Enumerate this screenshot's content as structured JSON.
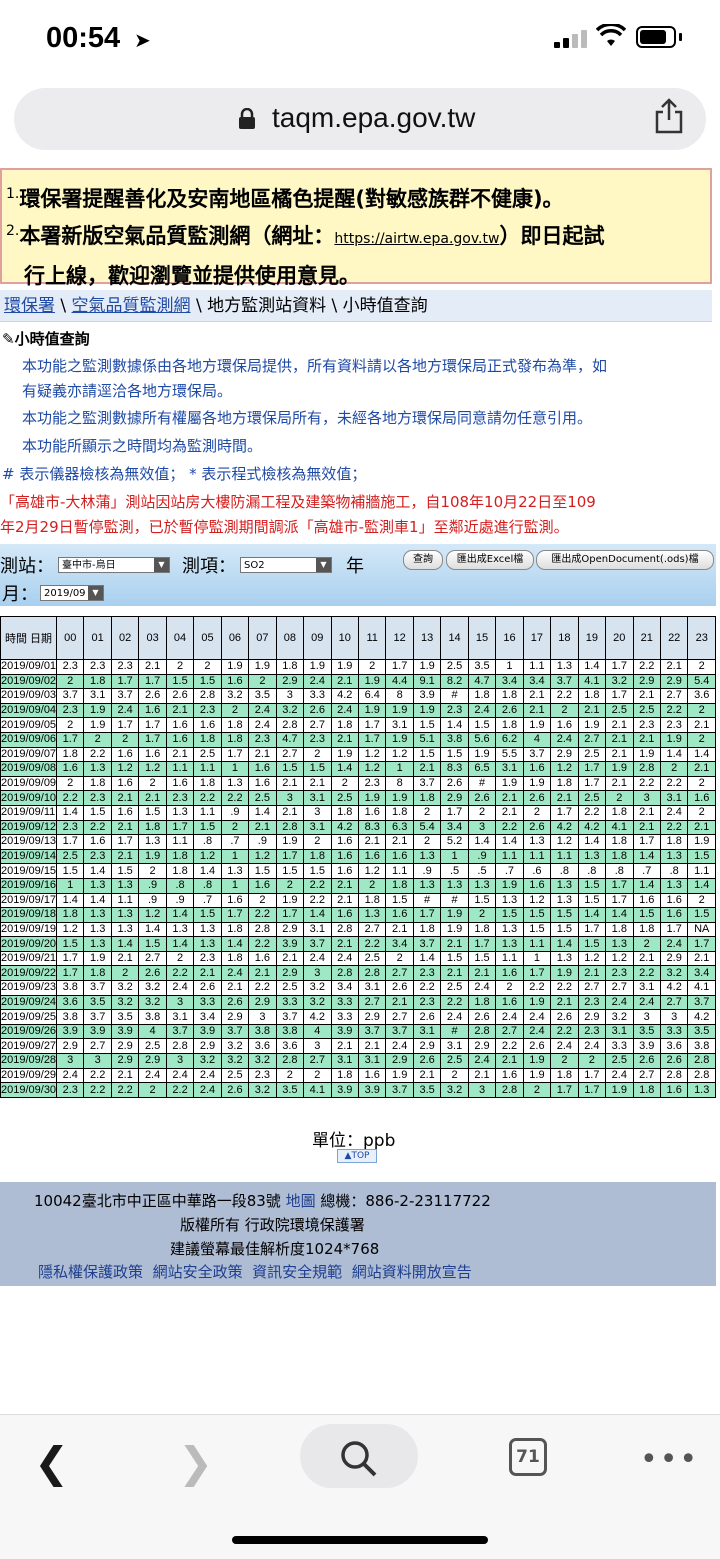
{
  "status": {
    "time": "00:54"
  },
  "browser": {
    "url": "taqm.epa.gov.tw",
    "tabs_count": "71"
  },
  "notice": {
    "item1_num": "1.",
    "item1": "環保署提醒善化及安南地區橘色提醒(對敏感族群不健康)。",
    "item2_num": "2.",
    "item2_a": "本署新版空氣品質監測網（網址：",
    "item2_link": "https://airtw.epa.gov.tw",
    "item2_b": "）即日起試",
    "item2_c": "行上線，歡迎瀏覽並提供使用意見。"
  },
  "breadcrumb": {
    "c1": "環保署",
    "c2": "空氣品質監測網",
    "c3": "地方監測站資料",
    "c4": "小時值查詢"
  },
  "page_title": "小時值查詢",
  "info": {
    "l1": "本功能之監測數據係由各地方環保局提供，所有資料請以各地方環保局正式發布為準，如",
    "l2": "有疑義亦請逕洽各地方環保局。",
    "l3": "本功能之監測數據所有權屬各地方環保局所有，未經各地方環保局同意請勿任意引用。",
    "l4": "本功能所顯示之時間均為監測時間。",
    "l5": "# 表示儀器檢核為無效值； * 表示程式檢核為無效值；",
    "w1": "「高雄市-大林蒲」測站因站房大樓防漏工程及建築物補牆施工，自108年10月22日至109",
    "w2": "年2月29日暫停監測，已於暫停監測期間調派「高雄市-監測車1」至鄰近處進行監測。"
  },
  "controls": {
    "station_label": "測站：",
    "station_value": "臺中市-烏日",
    "item_label": "測項：",
    "item_value": "SO2",
    "year_label": "年",
    "month_label": "月：",
    "month_value": "2019/09",
    "btn_query": "查詢",
    "btn_excel": "匯出成Excel檔",
    "btn_ods": "匯出成OpenDocument(.ods)檔"
  },
  "table": {
    "header_first": "時間 日期",
    "hours": [
      "00",
      "01",
      "02",
      "03",
      "04",
      "05",
      "06",
      "07",
      "08",
      "09",
      "10",
      "11",
      "12",
      "13",
      "14",
      "15",
      "16",
      "17",
      "18",
      "19",
      "20",
      "21",
      "22",
      "23"
    ],
    "rows": [
      [
        "2019/09/01",
        "2.3",
        "2.3",
        "2.3",
        "2.1",
        "2",
        "2",
        "1.9",
        "1.9",
        "1.8",
        "1.9",
        "1.9",
        "2",
        "1.7",
        "1.9",
        "2.5",
        "3.5",
        "1",
        "1.1",
        "1.3",
        "1.4",
        "1.7",
        "2.2",
        "2.1",
        "2"
      ],
      [
        "2019/09/02",
        "2",
        "1.8",
        "1.7",
        "1.7",
        "1.5",
        "1.5",
        "1.6",
        "2",
        "2.9",
        "2.4",
        "2.1",
        "1.9",
        "4.4",
        "9.1",
        "8.2",
        "4.7",
        "3.4",
        "3.4",
        "3.7",
        "4.1",
        "3.2",
        "2.9",
        "2.9",
        "5.4"
      ],
      [
        "2019/09/03",
        "3.7",
        "3.1",
        "3.7",
        "2.6",
        "2.6",
        "2.8",
        "3.2",
        "3.5",
        "3",
        "3.3",
        "4.2",
        "6.4",
        "8",
        "3.9",
        "#",
        "1.8",
        "1.8",
        "2.1",
        "2.2",
        "1.8",
        "1.7",
        "2.1",
        "2.7",
        "3.6"
      ],
      [
        "2019/09/04",
        "2.3",
        "1.9",
        "2.4",
        "1.6",
        "2.1",
        "2.3",
        "2",
        "2.4",
        "3.2",
        "2.6",
        "2.4",
        "1.9",
        "1.9",
        "1.9",
        "2.3",
        "2.4",
        "2.6",
        "2.1",
        "2",
        "2.1",
        "2.5",
        "2.5",
        "2.2",
        "2"
      ],
      [
        "2019/09/05",
        "2",
        "1.9",
        "1.7",
        "1.7",
        "1.6",
        "1.6",
        "1.8",
        "2.4",
        "2.8",
        "2.7",
        "1.8",
        "1.7",
        "3.1",
        "1.5",
        "1.4",
        "1.5",
        "1.8",
        "1.9",
        "1.6",
        "1.9",
        "2.1",
        "2.3",
        "2.3",
        "2.1"
      ],
      [
        "2019/09/06",
        "1.7",
        "2",
        "2",
        "1.7",
        "1.6",
        "1.8",
        "1.8",
        "2.3",
        "4.7",
        "2.3",
        "2.1",
        "1.7",
        "1.9",
        "5.1",
        "3.8",
        "5.6",
        "6.2",
        "4",
        "2.4",
        "2.7",
        "2.1",
        "2.1",
        "1.9",
        "2"
      ],
      [
        "2019/09/07",
        "1.8",
        "2.2",
        "1.6",
        "1.6",
        "2.1",
        "2.5",
        "1.7",
        "2.1",
        "2.7",
        "2",
        "1.9",
        "1.2",
        "1.2",
        "1.5",
        "1.5",
        "1.9",
        "5.5",
        "3.7",
        "2.9",
        "2.5",
        "2.1",
        "1.9",
        "1.4",
        "1.4"
      ],
      [
        "2019/09/08",
        "1.6",
        "1.3",
        "1.2",
        "1.2",
        "1.1",
        "1.1",
        "1",
        "1.6",
        "1.5",
        "1.5",
        "1.4",
        "1.2",
        "1",
        "2.1",
        "8.3",
        "6.5",
        "3.1",
        "1.6",
        "1.2",
        "1.7",
        "1.9",
        "2.8",
        "2",
        "2.1"
      ],
      [
        "2019/09/09",
        "2",
        "1.8",
        "1.6",
        "2",
        "1.6",
        "1.8",
        "1.3",
        "1.6",
        "2.1",
        "2.1",
        "2",
        "2.3",
        "8",
        "3.7",
        "2.6",
        "#",
        "1.9",
        "1.9",
        "1.8",
        "1.7",
        "2.1",
        "2.2",
        "2.2",
        "2"
      ],
      [
        "2019/09/10",
        "2.2",
        "2.3",
        "2.1",
        "2.1",
        "2.3",
        "2.2",
        "2.2",
        "2.5",
        "3",
        "3.1",
        "2.5",
        "1.9",
        "1.9",
        "1.8",
        "2.9",
        "2.6",
        "2.1",
        "2.6",
        "2.1",
        "2.5",
        "2",
        "3",
        "3.1",
        "1.6"
      ],
      [
        "2019/09/11",
        "1.4",
        "1.5",
        "1.6",
        "1.5",
        "1.3",
        "1.1",
        ".9",
        "1.4",
        "2.1",
        "3",
        "1.8",
        "1.6",
        "1.8",
        "2",
        "1.7",
        "2",
        "2.1",
        "2",
        "1.7",
        "2.2",
        "1.8",
        "2.1",
        "2.4",
        "2"
      ],
      [
        "2019/09/12",
        "2.3",
        "2.2",
        "2.1",
        "1.8",
        "1.7",
        "1.5",
        "2",
        "2.1",
        "2.8",
        "3.1",
        "4.2",
        "8.3",
        "6.3",
        "5.4",
        "3.4",
        "3",
        "2.2",
        "2.6",
        "4.2",
        "4.2",
        "4.1",
        "2.1",
        "2.2",
        "2.1"
      ],
      [
        "2019/09/13",
        "1.7",
        "1.6",
        "1.7",
        "1.3",
        "1.1",
        ".8",
        ".7",
        ".9",
        "1.9",
        "2",
        "1.6",
        "2.1",
        "2.1",
        "2",
        "5.2",
        "1.4",
        "1.4",
        "1.3",
        "1.2",
        "1.4",
        "1.8",
        "1.7",
        "1.8",
        "1.9"
      ],
      [
        "2019/09/14",
        "2.5",
        "2.3",
        "2.1",
        "1.9",
        "1.8",
        "1.2",
        "1",
        "1.2",
        "1.7",
        "1.8",
        "1.6",
        "1.6",
        "1.6",
        "1.3",
        "1",
        ".9",
        "1.1",
        "1.1",
        "1.1",
        "1.3",
        "1.8",
        "1.4",
        "1.3",
        "1.5"
      ],
      [
        "2019/09/15",
        "1.5",
        "1.4",
        "1.5",
        "2",
        "1.8",
        "1.4",
        "1.3",
        "1.5",
        "1.5",
        "1.5",
        "1.6",
        "1.2",
        "1.1",
        ".9",
        ".5",
        ".5",
        ".7",
        ".6",
        ".8",
        ".8",
        ".8",
        ".7",
        ".8",
        "1.1"
      ],
      [
        "2019/09/16",
        "1",
        "1.3",
        "1.3",
        ".9",
        ".8",
        ".8",
        "1",
        "1.6",
        "2",
        "2.2",
        "2.1",
        "2",
        "1.8",
        "1.3",
        "1.3",
        "1.3",
        "1.9",
        "1.6",
        "1.3",
        "1.5",
        "1.7",
        "1.4",
        "1.3",
        "1.4"
      ],
      [
        "2019/09/17",
        "1.4",
        "1.4",
        "1.1",
        ".9",
        ".9",
        ".7",
        "1.6",
        "2",
        "1.9",
        "2.2",
        "2.1",
        "1.8",
        "1.5",
        "#",
        "#",
        "1.5",
        "1.3",
        "1.2",
        "1.3",
        "1.5",
        "1.7",
        "1.6",
        "1.6",
        "2"
      ],
      [
        "2019/09/18",
        "1.8",
        "1.3",
        "1.3",
        "1.2",
        "1.4",
        "1.5",
        "1.7",
        "2.2",
        "1.7",
        "1.4",
        "1.6",
        "1.3",
        "1.6",
        "1.7",
        "1.9",
        "2",
        "1.5",
        "1.5",
        "1.5",
        "1.4",
        "1.4",
        "1.5",
        "1.6",
        "1.5"
      ],
      [
        "2019/09/19",
        "1.2",
        "1.3",
        "1.3",
        "1.4",
        "1.3",
        "1.3",
        "1.8",
        "2.8",
        "2.9",
        "3.1",
        "2.8",
        "2.7",
        "2.1",
        "1.8",
        "1.9",
        "1.8",
        "1.3",
        "1.5",
        "1.5",
        "1.7",
        "1.8",
        "1.8",
        "1.7",
        "NA"
      ],
      [
        "2019/09/20",
        "1.5",
        "1.3",
        "1.4",
        "1.5",
        "1.4",
        "1.3",
        "1.4",
        "2.2",
        "3.9",
        "3.7",
        "2.1",
        "2.2",
        "3.4",
        "3.7",
        "2.1",
        "1.7",
        "1.3",
        "1.1",
        "1.4",
        "1.5",
        "1.3",
        "2",
        "2.4",
        "1.7"
      ],
      [
        "2019/09/21",
        "1.7",
        "1.9",
        "2.1",
        "2.7",
        "2",
        "2.3",
        "1.8",
        "1.6",
        "2.1",
        "2.4",
        "2.4",
        "2.5",
        "2",
        "1.4",
        "1.5",
        "1.5",
        "1.1",
        "1",
        "1.3",
        "1.2",
        "1.2",
        "2.1",
        "2.9",
        "2.1"
      ],
      [
        "2019/09/22",
        "1.7",
        "1.8",
        "2",
        "2.6",
        "2.2",
        "2.1",
        "2.4",
        "2.1",
        "2.9",
        "3",
        "2.8",
        "2.8",
        "2.7",
        "2.3",
        "2.1",
        "2.1",
        "1.6",
        "1.7",
        "1.9",
        "2.1",
        "2.3",
        "2.2",
        "3.2",
        "3.4"
      ],
      [
        "2019/09/23",
        "3.8",
        "3.7",
        "3.2",
        "3.2",
        "2.4",
        "2.6",
        "2.1",
        "2.2",
        "2.5",
        "3.2",
        "3.4",
        "3.1",
        "2.6",
        "2.2",
        "2.5",
        "2.4",
        "2",
        "2.2",
        "2.2",
        "2.7",
        "2.7",
        "3.1",
        "4.2",
        "4.1"
      ],
      [
        "2019/09/24",
        "3.6",
        "3.5",
        "3.2",
        "3.2",
        "3",
        "3.3",
        "2.6",
        "2.9",
        "3.3",
        "3.2",
        "3.3",
        "2.7",
        "2.1",
        "2.3",
        "2.2",
        "1.8",
        "1.6",
        "1.9",
        "2.1",
        "2.3",
        "2.4",
        "2.4",
        "2.7",
        "3.7"
      ],
      [
        "2019/09/25",
        "3.8",
        "3.7",
        "3.5",
        "3.8",
        "3.1",
        "3.4",
        "2.9",
        "3",
        "3.7",
        "4.2",
        "3.3",
        "2.9",
        "2.7",
        "2.6",
        "2.4",
        "2.6",
        "2.4",
        "2.4",
        "2.6",
        "2.9",
        "3.2",
        "3",
        "3",
        "4.2"
      ],
      [
        "2019/09/26",
        "3.9",
        "3.9",
        "3.9",
        "4",
        "3.7",
        "3.9",
        "3.7",
        "3.8",
        "3.8",
        "4",
        "3.9",
        "3.7",
        "3.7",
        "3.1",
        "#",
        "2.8",
        "2.7",
        "2.4",
        "2.2",
        "2.3",
        "3.1",
        "3.5",
        "3.3",
        "3.5"
      ],
      [
        "2019/09/27",
        "2.9",
        "2.7",
        "2.9",
        "2.5",
        "2.8",
        "2.9",
        "3.2",
        "3.6",
        "3.6",
        "3",
        "2.1",
        "2.1",
        "2.4",
        "2.9",
        "3.1",
        "2.9",
        "2.2",
        "2.6",
        "2.4",
        "2.4",
        "3.3",
        "3.9",
        "3.6",
        "3.8"
      ],
      [
        "2019/09/28",
        "3",
        "3",
        "2.9",
        "2.9",
        "3",
        "3.2",
        "3.2",
        "3.2",
        "2.8",
        "2.7",
        "3.1",
        "3.1",
        "2.9",
        "2.6",
        "2.5",
        "2.4",
        "2.1",
        "1.9",
        "2",
        "2",
        "2.5",
        "2.6",
        "2.6",
        "2.8"
      ],
      [
        "2019/09/29",
        "2.4",
        "2.2",
        "2.1",
        "2.4",
        "2.4",
        "2.4",
        "2.5",
        "2.3",
        "2",
        "2",
        "1.8",
        "1.6",
        "1.9",
        "2.1",
        "2",
        "2.1",
        "1.6",
        "1.9",
        "1.8",
        "1.7",
        "2.4",
        "2.7",
        "2.8",
        "2.8"
      ],
      [
        "2019/09/30",
        "2.3",
        "2.2",
        "2.2",
        "2",
        "2.2",
        "2.4",
        "2.6",
        "3.2",
        "3.5",
        "4.1",
        "3.9",
        "3.9",
        "3.7",
        "3.5",
        "3.2",
        "3",
        "2.8",
        "2",
        "1.7",
        "1.7",
        "1.9",
        "1.8",
        "1.6",
        "1.3"
      ]
    ]
  },
  "unit_text": "單位：ppb",
  "top_link": "TOP",
  "footer": {
    "addr": "10042臺北市中正區中華路一段83號",
    "map": "地圖",
    "phone": "總機：886-2-23117722",
    "copyright": "版權所有  行政院環境保護署",
    "resolution": "建議螢幕最佳解析度1024*768",
    "links": [
      "隱私權保護政策",
      "網站安全政策",
      "資訊安全規範",
      "網站資料開放宣告"
    ]
  }
}
